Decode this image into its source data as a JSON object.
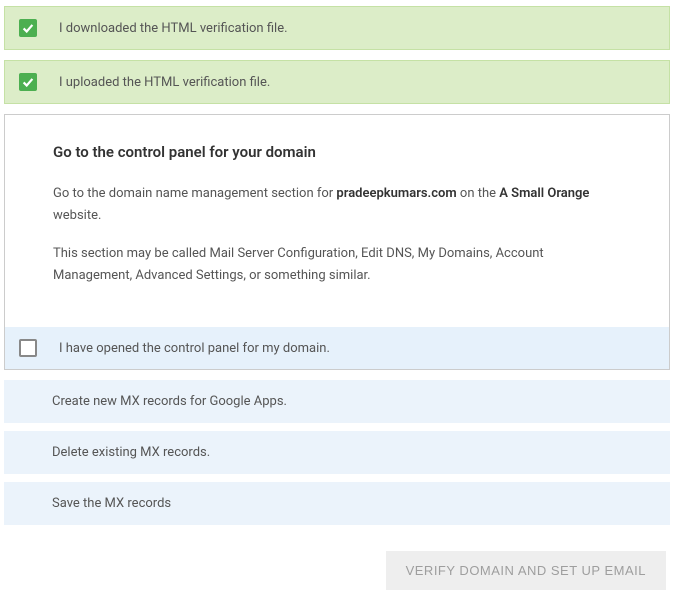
{
  "steps_done": [
    {
      "label": "I downloaded the HTML verification file."
    },
    {
      "label": "I uploaded the HTML verification file."
    }
  ],
  "panel": {
    "title": "Go to the control panel for your domain",
    "text1_pre": "Go to the domain name management section for ",
    "text1_domain": "pradeepkumars.com",
    "text1_mid": " on the ",
    "text1_host": "A Small Orange",
    "text1_post": " website.",
    "text2": "This section may be called Mail Server Configuration, Edit DNS, My Domains, Account Management, Advanced Settings, or something similar.",
    "confirm_label": "I have opened the control panel for my domain."
  },
  "future_steps": [
    "Create new MX records for Google Apps.",
    "Delete existing MX records.",
    "Save the MX records"
  ],
  "verify_button": "VERIFY DOMAIN AND SET UP EMAIL"
}
